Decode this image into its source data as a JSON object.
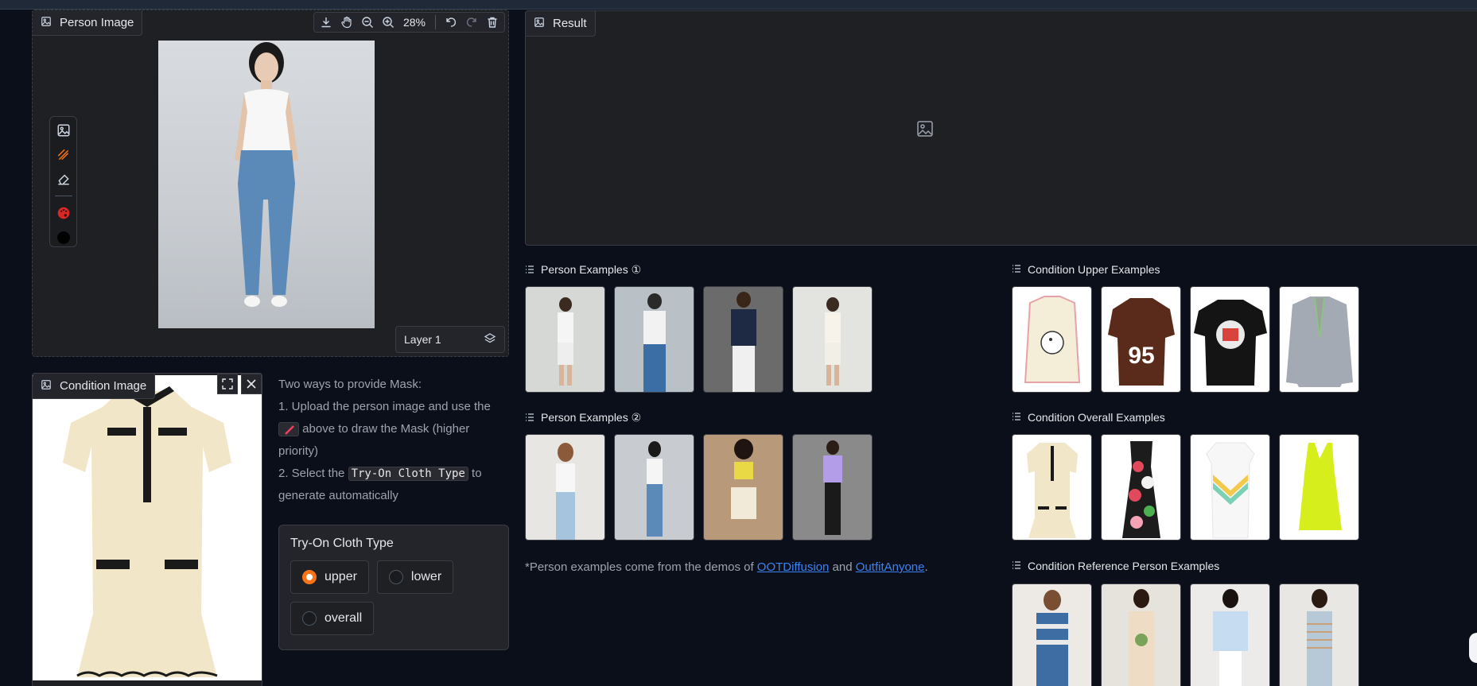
{
  "person_panel": {
    "label": "Person Image",
    "zoom": "28%",
    "layer": "Layer 1"
  },
  "condition_panel": {
    "label": "Condition Image"
  },
  "info": {
    "line1": "Two ways to provide Mask:",
    "line2": "1. Upload the person image and use the",
    "line3": "above to draw the Mask (higher priority)",
    "line4a": "2. Select the",
    "line4code": "Try-On Cloth Type",
    "line4b": "to generate automatically"
  },
  "cloth_type": {
    "title": "Try-On Cloth Type",
    "options": [
      "upper",
      "lower",
      "overall"
    ],
    "selected": "upper"
  },
  "result_panel": {
    "label": "Result"
  },
  "examples": {
    "person1_label": "Person Examples ①",
    "person2_label": "Person Examples ②",
    "cond_upper_label": "Condition Upper Examples",
    "cond_overall_label": "Condition Overall Examples",
    "cond_ref_label": "Condition Reference Person Examples"
  },
  "note": {
    "prefix": "*Person examples come from the demos of ",
    "link1": "OOTDiffusion",
    "middle": " and ",
    "link2": "OutfitAnyone",
    "suffix": "."
  },
  "icons": {
    "image": "image-icon",
    "download": "download-icon",
    "pan": "hand-icon",
    "zoom_out": "zoom-out-icon",
    "zoom_in": "zoom-in-icon",
    "undo": "undo-icon",
    "redo": "redo-icon",
    "delete": "trash-icon",
    "brush": "brush-icon",
    "eraser": "eraser-icon",
    "palette": "palette-icon",
    "layers": "layers-icon",
    "fullscreen": "fullscreen-icon",
    "close": "close-icon",
    "list": "list-icon"
  },
  "colors": {
    "accent": "#f97316",
    "link": "#3b82f6",
    "background": "#0b0f19"
  }
}
